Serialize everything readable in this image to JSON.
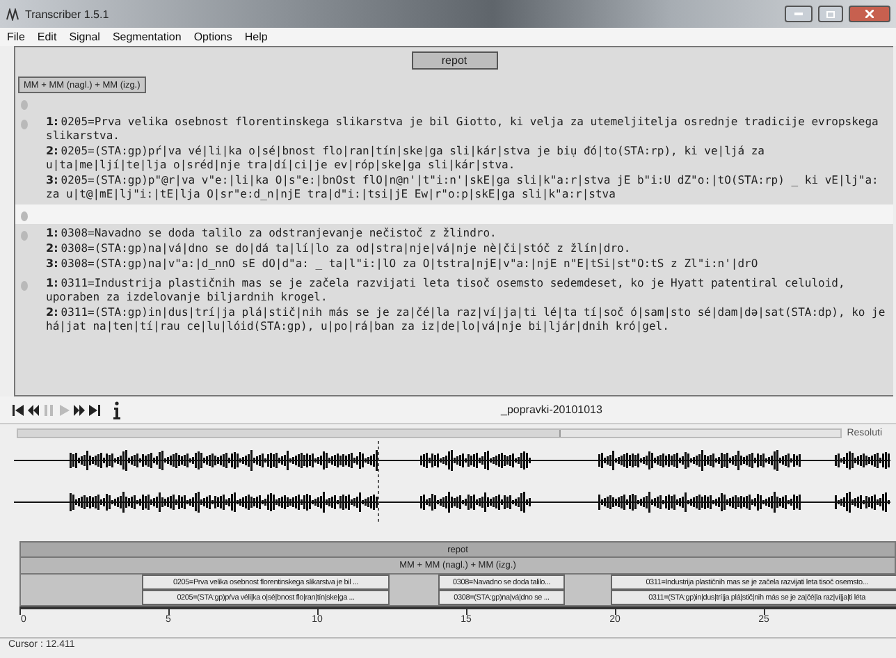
{
  "window": {
    "title": "Transcriber 1.5.1"
  },
  "menu": [
    "File",
    "Edit",
    "Signal",
    "Segmentation",
    "Options",
    "Help"
  ],
  "editor": {
    "section_button": "repot",
    "turn_button": "MM + MM (nagl.) + MM (izg.)",
    "segments": [
      {
        "selected": false,
        "lines": [
          {
            "num": "1:",
            "text": "0205=Prva velika osebnost florentinskega slikarstva je bil Giotto, ki velja za utemeljitelja osrednje tradicije evropskega slikarstva."
          },
          {
            "num": "2:",
            "text": "0205=(STA:gp)pŕ|va vé|li|ka o|sé|bnost flo|ran|tín|ske|ga sli|kár|stva je biụ đó|to(STA:rp), ki ve|ljá za u|ta|me|ljí|te|lja o|sréd|nje tra|dí|ci|je ev|róp|ske|ga sli|kár|stva."
          },
          {
            "num": "3:",
            "text": "0205=(STA:gp)p\"@r|va v\"e:|li|ka O|s\"e:|bnOst flO|n@n'|t\"i:n'|skE|ga sli|k\"a:r|stva jE b\"i:U dZ\"o:|tO(STA:rp) _ ki vE|lj\"a: za u|t@|mE|lj\"i:|tE|lja O|sr\"e:d_n|njE tra|d\"i:|tsi|jE Ew|r\"o:p|skE|ga sli|k\"a:r|stva"
          }
        ]
      },
      {
        "selected": true
      },
      {
        "selected": false,
        "lines": [
          {
            "num": "1:",
            "text": "0308=Navadno se doda talilo za odstranjevanje nečistoč z žlindro."
          },
          {
            "num": "2:",
            "text": "0308=(STA:gp)na|vá|dno se do|dá ta|lí|lo za od|stra|nje|vá|nje nè|či|stóč z žlín|dro."
          },
          {
            "num": "3:",
            "text": "0308=(STA:gp)na|v\"a:|d_nnO sE dO|d\"a: _ ta|l\"i:|lO za O|tstra|njE|v\"a:|njE n\"E|tSi|st\"O:tS z Zl\"i:n'|drO"
          }
        ]
      },
      {
        "selected": false,
        "lines": [
          {
            "num": "1:",
            "text": "0311=Industrija plastičnih mas se je začela razvijati leta tisoč osemsto sedemdeset, ko je Hyatt patentiral celuloid, uporaben za izdelovanje biljardnih krogel."
          },
          {
            "num": "2:",
            "text": "0311=(STA:gp)in|dus|trí|ja plá|stič|nih más se je za|čé|la raz|ví|ja|ti lé|ta tí|soč ó|sam|sto sé|dam|də|sat(STA:dp), ko je há|jat na|ten|tí|rau ce|lu|lóid(STA:gp), u|po|rá|ban za iz|de|lo|vá|nje bi|ljár|dnih kró|gel."
          }
        ]
      }
    ]
  },
  "player": {
    "file": "_popravki-20101013",
    "resolution": "Resoluti"
  },
  "timeline": {
    "section": "repot",
    "turn": "MM + MM (nagl.) + MM (izg.)",
    "segments": [
      {
        "line1": "0205=Prva velika osebnost florentinskega slikarstva je bil ...",
        "line2": "0205=(STA:gp)pŕva véli|ka o|sé|bnost flo|ran|tín|ske|ga ..."
      },
      {
        "line1": "0308=Navadno se doda talilo...",
        "line2": "0308=(STA:gp)na|vá|dno se ..."
      },
      {
        "line1": "0311=Industrija plastičnih mas se je začela razvijati leta tisoč osemsto...",
        "line2": "0311=(STA:gp)in|dus|trí|ja plá|stič|nih más se je za|čé|la raz|ví|ja|ti léta"
      }
    ],
    "ticks": [
      "0",
      "5",
      "10",
      "15",
      "20",
      "25"
    ]
  },
  "status_bar": {
    "cursor": "Cursor : 12.411"
  }
}
